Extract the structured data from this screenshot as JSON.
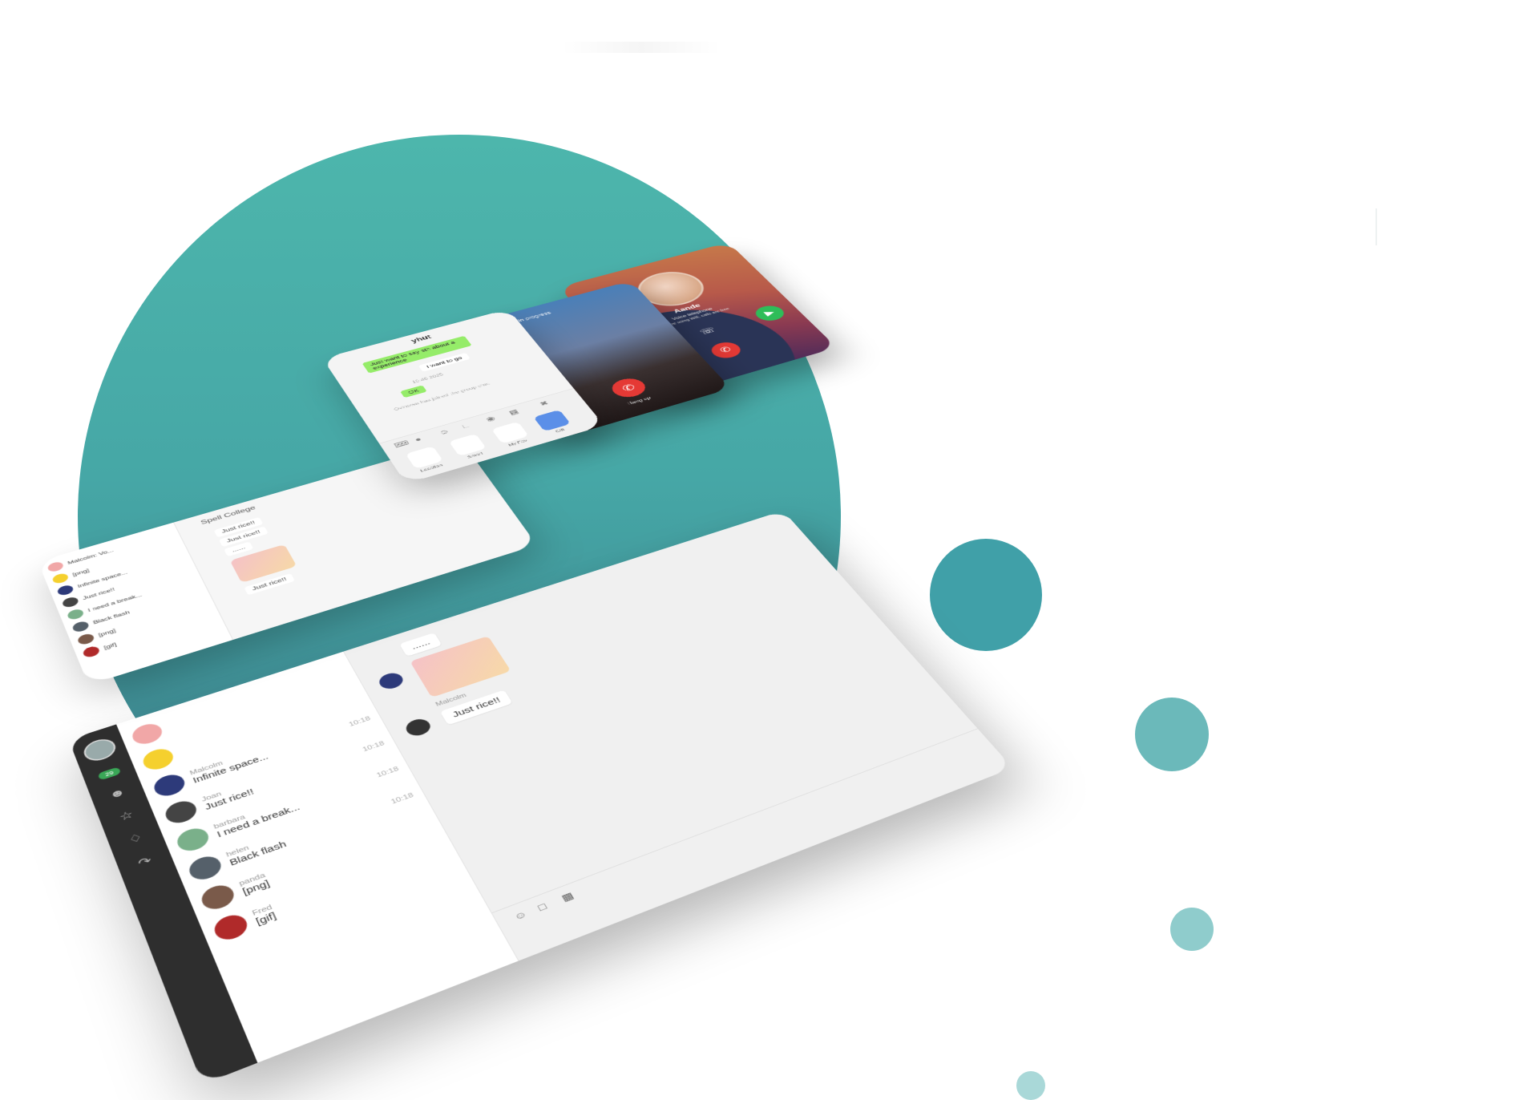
{
  "colors": {
    "teal": "#46a7a6",
    "teal_light": "#8fcccc",
    "green_bubble": "#95ec69",
    "decline_red": "#e53935",
    "accept_green": "#2ebd59",
    "rail_dark": "#2e2e2e"
  },
  "desktop": {
    "rail_badge": "29",
    "rail_icons": [
      "contacts-icon",
      "star-icon",
      "bell-icon",
      "share-icon"
    ],
    "conversations": [
      {
        "name": "Malcolm",
        "msg": "Infinite space...",
        "time": "10:18"
      },
      {
        "name": "Joan",
        "msg": "Just rice!!",
        "time": "10:18"
      },
      {
        "name": "barbara",
        "msg": "I need a break...",
        "time": "10:18"
      },
      {
        "name": "helen",
        "msg": "Black flash",
        "time": "10:18"
      },
      {
        "name": "panda",
        "msg": "[png]",
        "time": ""
      },
      {
        "name": "Fred",
        "msg": "[gif]",
        "time": ""
      }
    ],
    "chat": {
      "dots": "......",
      "sticker_sender": "Malcolm",
      "bubble": "Just rice!!"
    }
  },
  "mini": {
    "title": "Spell College",
    "list": [
      {
        "name": "Malcolm",
        "msg": "Malcolm: Vo..."
      },
      {
        "name": "",
        "msg": "[png]"
      },
      {
        "name": "Malcolm",
        "msg": "Infinite space..."
      },
      {
        "name": "",
        "msg": "Just rice!!"
      },
      {
        "name": "",
        "msg": "I need a break..."
      },
      {
        "name": "",
        "msg": "Black flash"
      },
      {
        "name": "",
        "msg": "[png]"
      },
      {
        "name": "",
        "msg": "[gif]"
      }
    ],
    "bubbles": [
      "Just rice!!",
      "Just rice!!",
      "......",
      "Just rice!!"
    ]
  },
  "phone_chat": {
    "title": "yhut",
    "messages": [
      "Just want to say sth about a experience",
      "I want to go",
      "OK"
    ],
    "system": [
      "10:46 2025",
      "Ovinowa has joined the group chat"
    ],
    "tray_labels": [
      "Location",
      "Smart",
      "My Fav",
      "Gift"
    ]
  },
  "video_call": {
    "hangup_label": "Hang up",
    "status": "Voice call in progress"
  },
  "voice_call": {
    "name": "Aande",
    "subtitle": "Voice telephone",
    "note": "You're using Wifi, calls are free"
  }
}
